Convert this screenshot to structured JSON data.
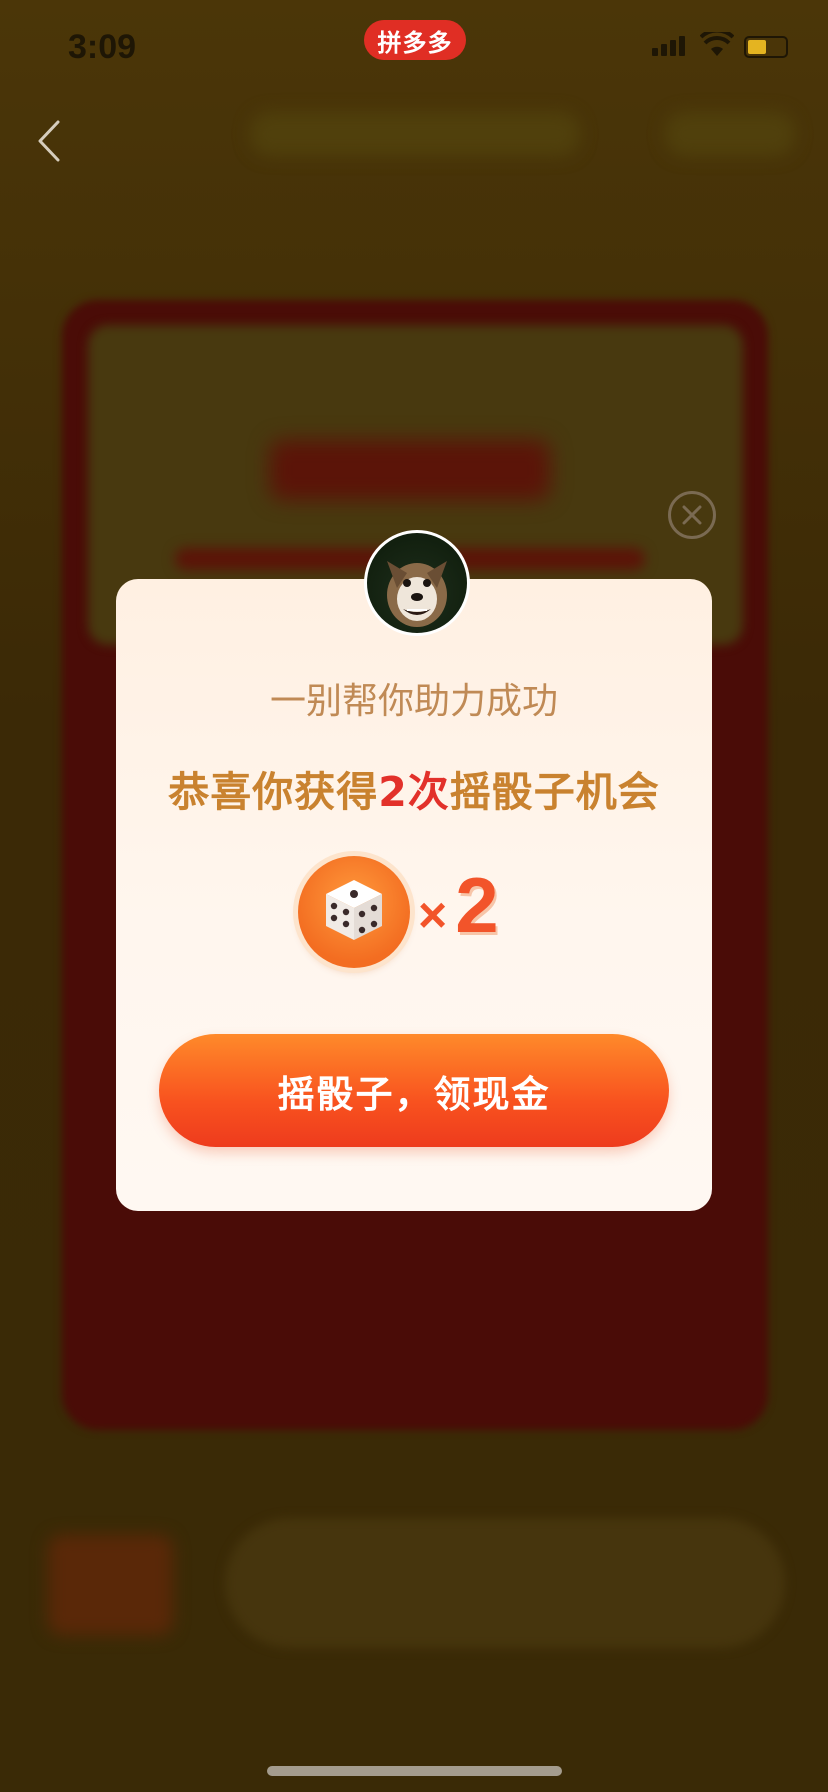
{
  "status_bar": {
    "time": "3:09",
    "app_badge": "拼多多"
  },
  "modal": {
    "subtitle": "一别帮你助力成功",
    "headline_prefix": "恭喜你获得",
    "headline_highlight": "2次",
    "headline_suffix": "摇骰子机会",
    "multiplier_symbol": "×",
    "multiplier_count": "2",
    "cta_label": "摇骰子，领现金"
  },
  "icons": {
    "back": "back-chevron-icon",
    "close": "close-circle-icon",
    "dice": "dice-icon",
    "avatar": "dog-avatar"
  },
  "colors": {
    "headline": "#c9822f",
    "highlight": "#e2312a",
    "cta_start": "#ff8a2a",
    "cta_end": "#ee3b1d",
    "badge": "#e02e24"
  }
}
